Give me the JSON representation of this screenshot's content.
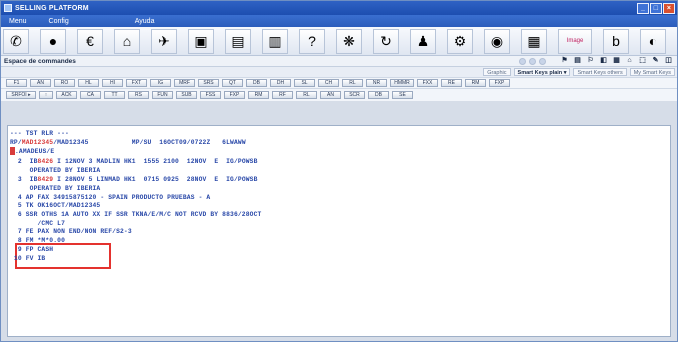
{
  "window": {
    "title": "SELLING PLATFORM",
    "min": "_",
    "max": "□",
    "close": "×"
  },
  "menu": [
    "Menu",
    "Config",
    "Ayuda"
  ],
  "toolbar": {
    "icons": [
      "globe-icon",
      "record-icon",
      "euro-icon",
      "hotel-icon",
      "plane-icon",
      "car-icon",
      "train-icon",
      "cruise-icon",
      "help-icon",
      "star-icon",
      "refresh-icon",
      "person-icon",
      "gear-icon",
      "info-icon",
      "calendar-icon"
    ],
    "glyphs": [
      "✆",
      "●",
      "€",
      "⌂",
      "✈",
      "▣",
      "▤",
      "▥",
      "?",
      "❋",
      "↻",
      "♟",
      "⚙",
      "◉",
      "▦"
    ],
    "wide_label": "Image",
    "last_glyphs": [
      "b",
      "◐"
    ]
  },
  "subheader": {
    "title": "Espace de commandes",
    "mini_glyphs": [
      "⚑",
      "▤",
      "⚐",
      "◧",
      "▦",
      "⌂",
      "⬚",
      "✎",
      "◫"
    ]
  },
  "bar3": {
    "buttons": [
      "Graphic",
      "Smart Keys plain ▾",
      "Smart Keys others",
      "My Smart Keys"
    ]
  },
  "keys_row1": [
    "F1",
    "AN",
    "RO",
    "HL",
    "HI",
    "FXT",
    "IG",
    "MRF",
    "SRS",
    "QT",
    "DB",
    "DH",
    "SL",
    "CH",
    "RL",
    "NR",
    "HMMR",
    "FXX",
    "RE",
    "RM",
    "FXP"
  ],
  "keys_row2": [
    "SRFOI ▸",
    "↑",
    "ACK",
    "CA",
    "TT",
    "RS",
    "FUN",
    "SUB",
    "FSS",
    "FXP",
    "RM",
    "RF",
    "RL",
    "AN",
    "SCR",
    "DB",
    "SE"
  ],
  "terminal": {
    "lines": [
      {
        "segments": [
          {
            "t": "--- TST RLR ---",
            "c": "blue"
          }
        ]
      },
      {
        "segments": [
          {
            "t": "RP/",
            "c": "blue"
          },
          {
            "t": "MAD12345",
            "c": "red"
          },
          {
            "t": "/MAD12345           MP/SU  16OCT09/0722Z   6LWAWW",
            "c": "blue"
          }
        ]
      },
      {
        "segments": [
          {
            "t": "CURSOR",
            "c": "cursor"
          },
          {
            "t": ".AMADEUS/E",
            "c": "blue"
          }
        ]
      },
      {
        "segments": [
          {
            "t": "  2  IB",
            "c": "blue"
          },
          {
            "t": "8426",
            "c": "red"
          },
          {
            "t": " I 12NOV 3 MADLIN HK1  1555 2100  12NOV  E  IG/POWSB",
            "c": "blue"
          }
        ]
      },
      {
        "segments": [
          {
            "t": "     OPERATED BY IBERIA",
            "c": "blue"
          }
        ]
      },
      {
        "segments": [
          {
            "t": "  3  IB",
            "c": "blue"
          },
          {
            "t": "8429",
            "c": "red"
          },
          {
            "t": " I 28NOV 5 LINMAD HK1  0715 0925  28NOV  E  IG/POWSB",
            "c": "blue"
          }
        ]
      },
      {
        "segments": [
          {
            "t": "     OPERATED BY IBERIA",
            "c": "blue"
          }
        ]
      },
      {
        "segments": [
          {
            "t": "  4 AP FAX 34915875120 - SPAIN PRODUCTO PRUEBAS - A",
            "c": "blue"
          }
        ]
      },
      {
        "segments": [
          {
            "t": "  5 TK OK16OCT/MAD12345",
            "c": "blue"
          }
        ]
      },
      {
        "segments": [
          {
            "t": "  6 SSR OTHS 1A AUTO XX IF SSR TKNA/E/M/C NOT RCVD BY 8836/28OCT",
            "c": "blue"
          }
        ]
      },
      {
        "segments": [
          {
            "t": "       /CMC L7",
            "c": "blue"
          }
        ]
      },
      {
        "segments": [
          {
            "t": "  7 FE PAX NON END/NON REF/S2-3",
            "c": "blue"
          }
        ]
      },
      {
        "segments": [
          {
            "t": "  8 FM *M*0.00",
            "c": "blue"
          }
        ]
      },
      {
        "segments": [
          {
            "t": "  9 FP CASH",
            "c": "blue"
          }
        ]
      },
      {
        "segments": [
          {
            "t": " 10 FV IB",
            "c": "blue"
          }
        ]
      }
    ]
  }
}
